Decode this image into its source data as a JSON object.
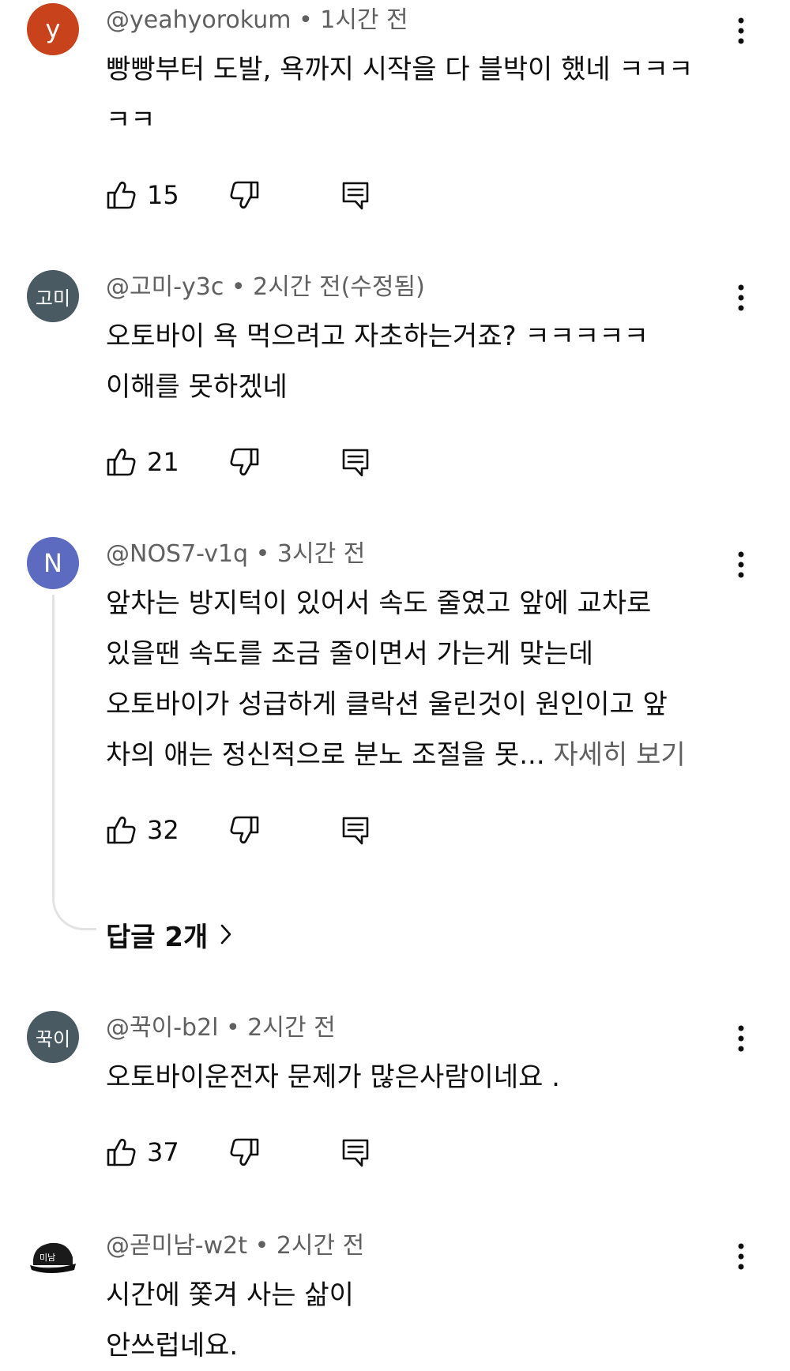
{
  "comments": [
    {
      "avatar_text": "y",
      "avatar_color": "#c8431c",
      "author": "@yeahyorokum",
      "time": "1시간 전",
      "body": "빵빵부터 도발, 욕까지 시작을 다 블박이 했네 ㅋㅋㅋ\nㅋㅋ",
      "likes": "15"
    },
    {
      "avatar_text": "고미",
      "avatar_color": "#4a5a63",
      "author": "@고미-y3c",
      "time": "2시간 전(수정됨)",
      "body": "오토바이 욕 먹으려고 자초하는거죠? ㅋㅋㅋㅋㅋ\n이해를 못하겠네",
      "likes": "21"
    },
    {
      "avatar_text": "N",
      "avatar_color": "#5c6bc0",
      "author": "@NOS7-v1q",
      "time": "3시간 전",
      "body": "앞차는 방지턱이 있어서 속도 줄였고 앞에 교차로\n있을땐 속도를 조금 줄이면서 가는게 맞는데\n오토바이가 성급하게 클락션 울린것이 원인이고 앞\n차의 애는 정신적으로 분노 조절을 못...",
      "read_more": "자세히 보기",
      "likes": "32",
      "replies_label": "답글 2개"
    },
    {
      "avatar_text": "꾹이",
      "avatar_color": "#4a5a63",
      "author": "@꾹이-b2l",
      "time": "2시간 전",
      "body": "오토바이운전자 문제가 많은사람이네요 .",
      "likes": "37"
    },
    {
      "avatar_text": "미남",
      "avatar_color": "#1a1a1a",
      "author": "@곧미남-w2t",
      "time": "2시간 전",
      "body": "시간에 쫓겨 사는 삶이\n안쓰럽네요."
    }
  ],
  "separator": "•",
  "icons": {
    "like": "thumb-up-icon",
    "dislike": "thumb-down-icon",
    "reply": "reply-icon",
    "more": "more-vertical-icon",
    "chevron": "chevron-right-icon"
  }
}
